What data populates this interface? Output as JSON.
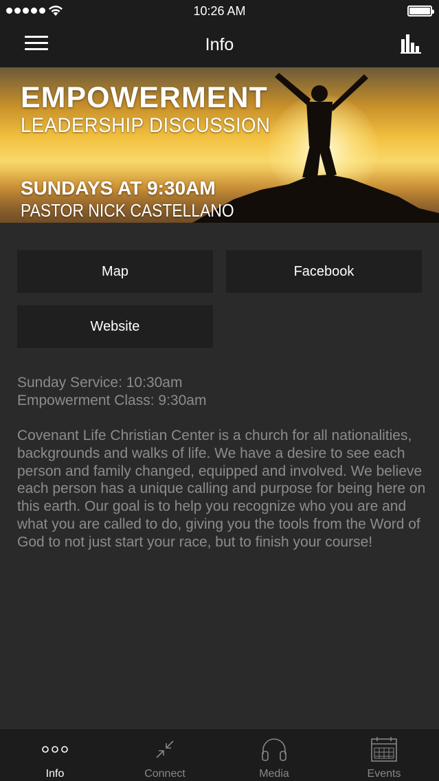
{
  "status_bar": {
    "time": "10:26 AM"
  },
  "nav": {
    "title": "Info",
    "menu_icon": "hamburger-menu-icon",
    "stats_icon": "bar-chart-icon"
  },
  "banner": {
    "headline": "EMPOWERMENT",
    "subhead": "LEADERSHIP DISCUSSION",
    "when": "SUNDAYS AT 9:30AM",
    "pastor": "PASTOR NICK CASTELLANO"
  },
  "buttons": {
    "map": "Map",
    "facebook": "Facebook",
    "website": "Website"
  },
  "hours": {
    "line1": "Sunday Service: 10:30am",
    "line2": "Empowerment Class: 9:30am"
  },
  "about": "Covenant Life Christian Center is a church for all nationalities, backgrounds and walks of life. We have a desire to see each person and family changed, equipped and involved. We believe each person has a unique calling and purpose for being here on this earth. Our goal is to help you recognize who you are and what you are called to do, giving you the tools from the Word of God to not just start your race, but to finish your course!",
  "tabs": [
    {
      "label": "Info",
      "icon": "three-dots-icon",
      "active": true
    },
    {
      "label": "Connect",
      "icon": "connect-arrows-icon",
      "active": false
    },
    {
      "label": "Media",
      "icon": "headphones-icon",
      "active": false
    },
    {
      "label": "Events",
      "icon": "calendar-icon",
      "active": false
    }
  ],
  "colors": {
    "background": "#2a2a2a",
    "bar": "#1c1c1c",
    "button": "#1f1f1f",
    "muted_text": "#8c8c8c"
  }
}
